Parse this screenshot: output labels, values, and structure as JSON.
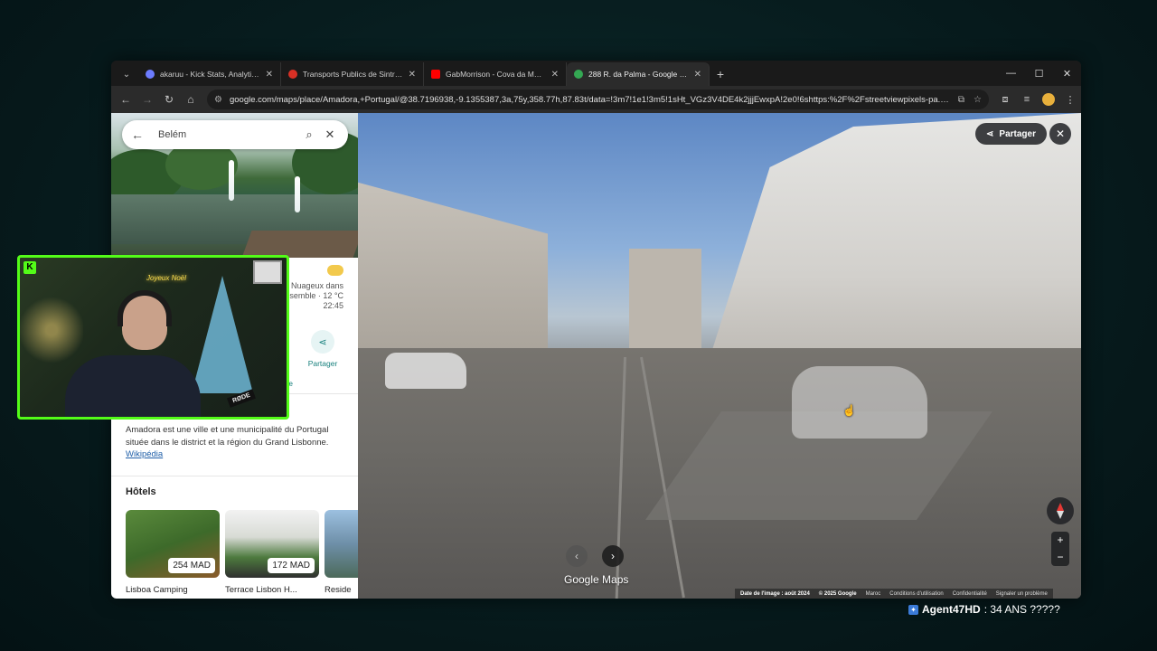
{
  "browser": {
    "tabs": [
      {
        "title": "akaruu - Kick Stats, Analytics an",
        "favicon_color": "#6c7cff"
      },
      {
        "title": "Transports Publics de Sintra, Po",
        "favicon_color": "#d93025"
      },
      {
        "title": "GabMorrison - Cova da Moura",
        "favicon_color": "#ff0000"
      },
      {
        "title": "288 R. da Palma - Google Maps",
        "favicon_color": "#34a853",
        "active": true
      }
    ],
    "url": "google.com/maps/place/Amadora,+Portugal/@38.7196938,-9.1355387,3a,75y,358.77h,87.83t/data=!3m7!1e1!3m5!1sHt_VGz3V4DE4k2jjjEwxpA!2e0!6shttps:%2F%2Fstreetviewpixels-pa.go..."
  },
  "maps_panel": {
    "search_value": "Belém",
    "weather": {
      "line1": "Nuageux dans",
      "line2": "semble · 12 °C",
      "time": "22:45"
    },
    "share_label": "Partager",
    "action_stub_1": "r",
    "action_stub_2": "ne",
    "description": "Amadora est une ville et une municipalité du Portugal située dans le district et la région du Grand Lisbonne.",
    "description_link": "Wikipédia",
    "hotels_title": "Hôtels",
    "hotels": [
      {
        "name": "Lisboa Camping",
        "price": "254 MAD"
      },
      {
        "name": "Terrace Lisbon H...",
        "price": "172 MAD"
      },
      {
        "name": "Reside",
        "price": ""
      }
    ]
  },
  "streetview": {
    "share_label": "Partager",
    "brand": "Google Maps",
    "footer": {
      "image_date": "Date de l'image : août 2024",
      "copyright": "© 2025 Google",
      "region": "Maroc",
      "terms": "Conditions d'utilisation",
      "privacy": "Confidentialité",
      "report": "Signaler un problème"
    }
  },
  "webcam": {
    "platform_logo": "K",
    "neon_sign": "Joyeux Noël",
    "mic_brand": "RØDE"
  },
  "chat": {
    "username": "Agent47HD",
    "message": ": 34 ANS ?????"
  }
}
